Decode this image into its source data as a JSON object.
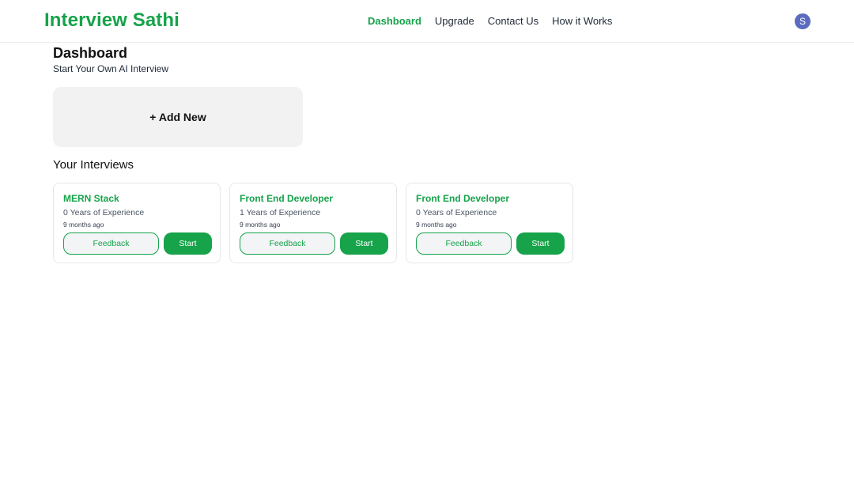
{
  "header": {
    "logo": "Interview Sathi",
    "nav": [
      {
        "label": "Dashboard",
        "active": true
      },
      {
        "label": "Upgrade",
        "active": false
      },
      {
        "label": "Contact Us",
        "active": false
      },
      {
        "label": "How it Works",
        "active": false
      }
    ],
    "avatar_initial": "S"
  },
  "dashboard": {
    "title": "Dashboard",
    "subtitle": "Start Your Own AI Interview",
    "add_new_label": "+ Add New"
  },
  "interviews": {
    "section_title": "Your Interviews",
    "items": [
      {
        "role": "MERN Stack",
        "experience": "0 Years of Experience",
        "created": "9 months ago",
        "feedback_label": "Feedback",
        "start_label": "Start"
      },
      {
        "role": "Front End Developer",
        "experience": "1 Years of Experience",
        "created": "9 months ago",
        "feedback_label": "Feedback",
        "start_label": "Start"
      },
      {
        "role": "Front End Developer",
        "experience": "0 Years of Experience",
        "created": "9 months ago",
        "feedback_label": "Feedback",
        "start_label": "Start"
      }
    ]
  },
  "colors": {
    "brand_green": "#16a34a",
    "avatar_bg": "#5b6bbf",
    "add_card_bg": "#f2f2f2"
  }
}
